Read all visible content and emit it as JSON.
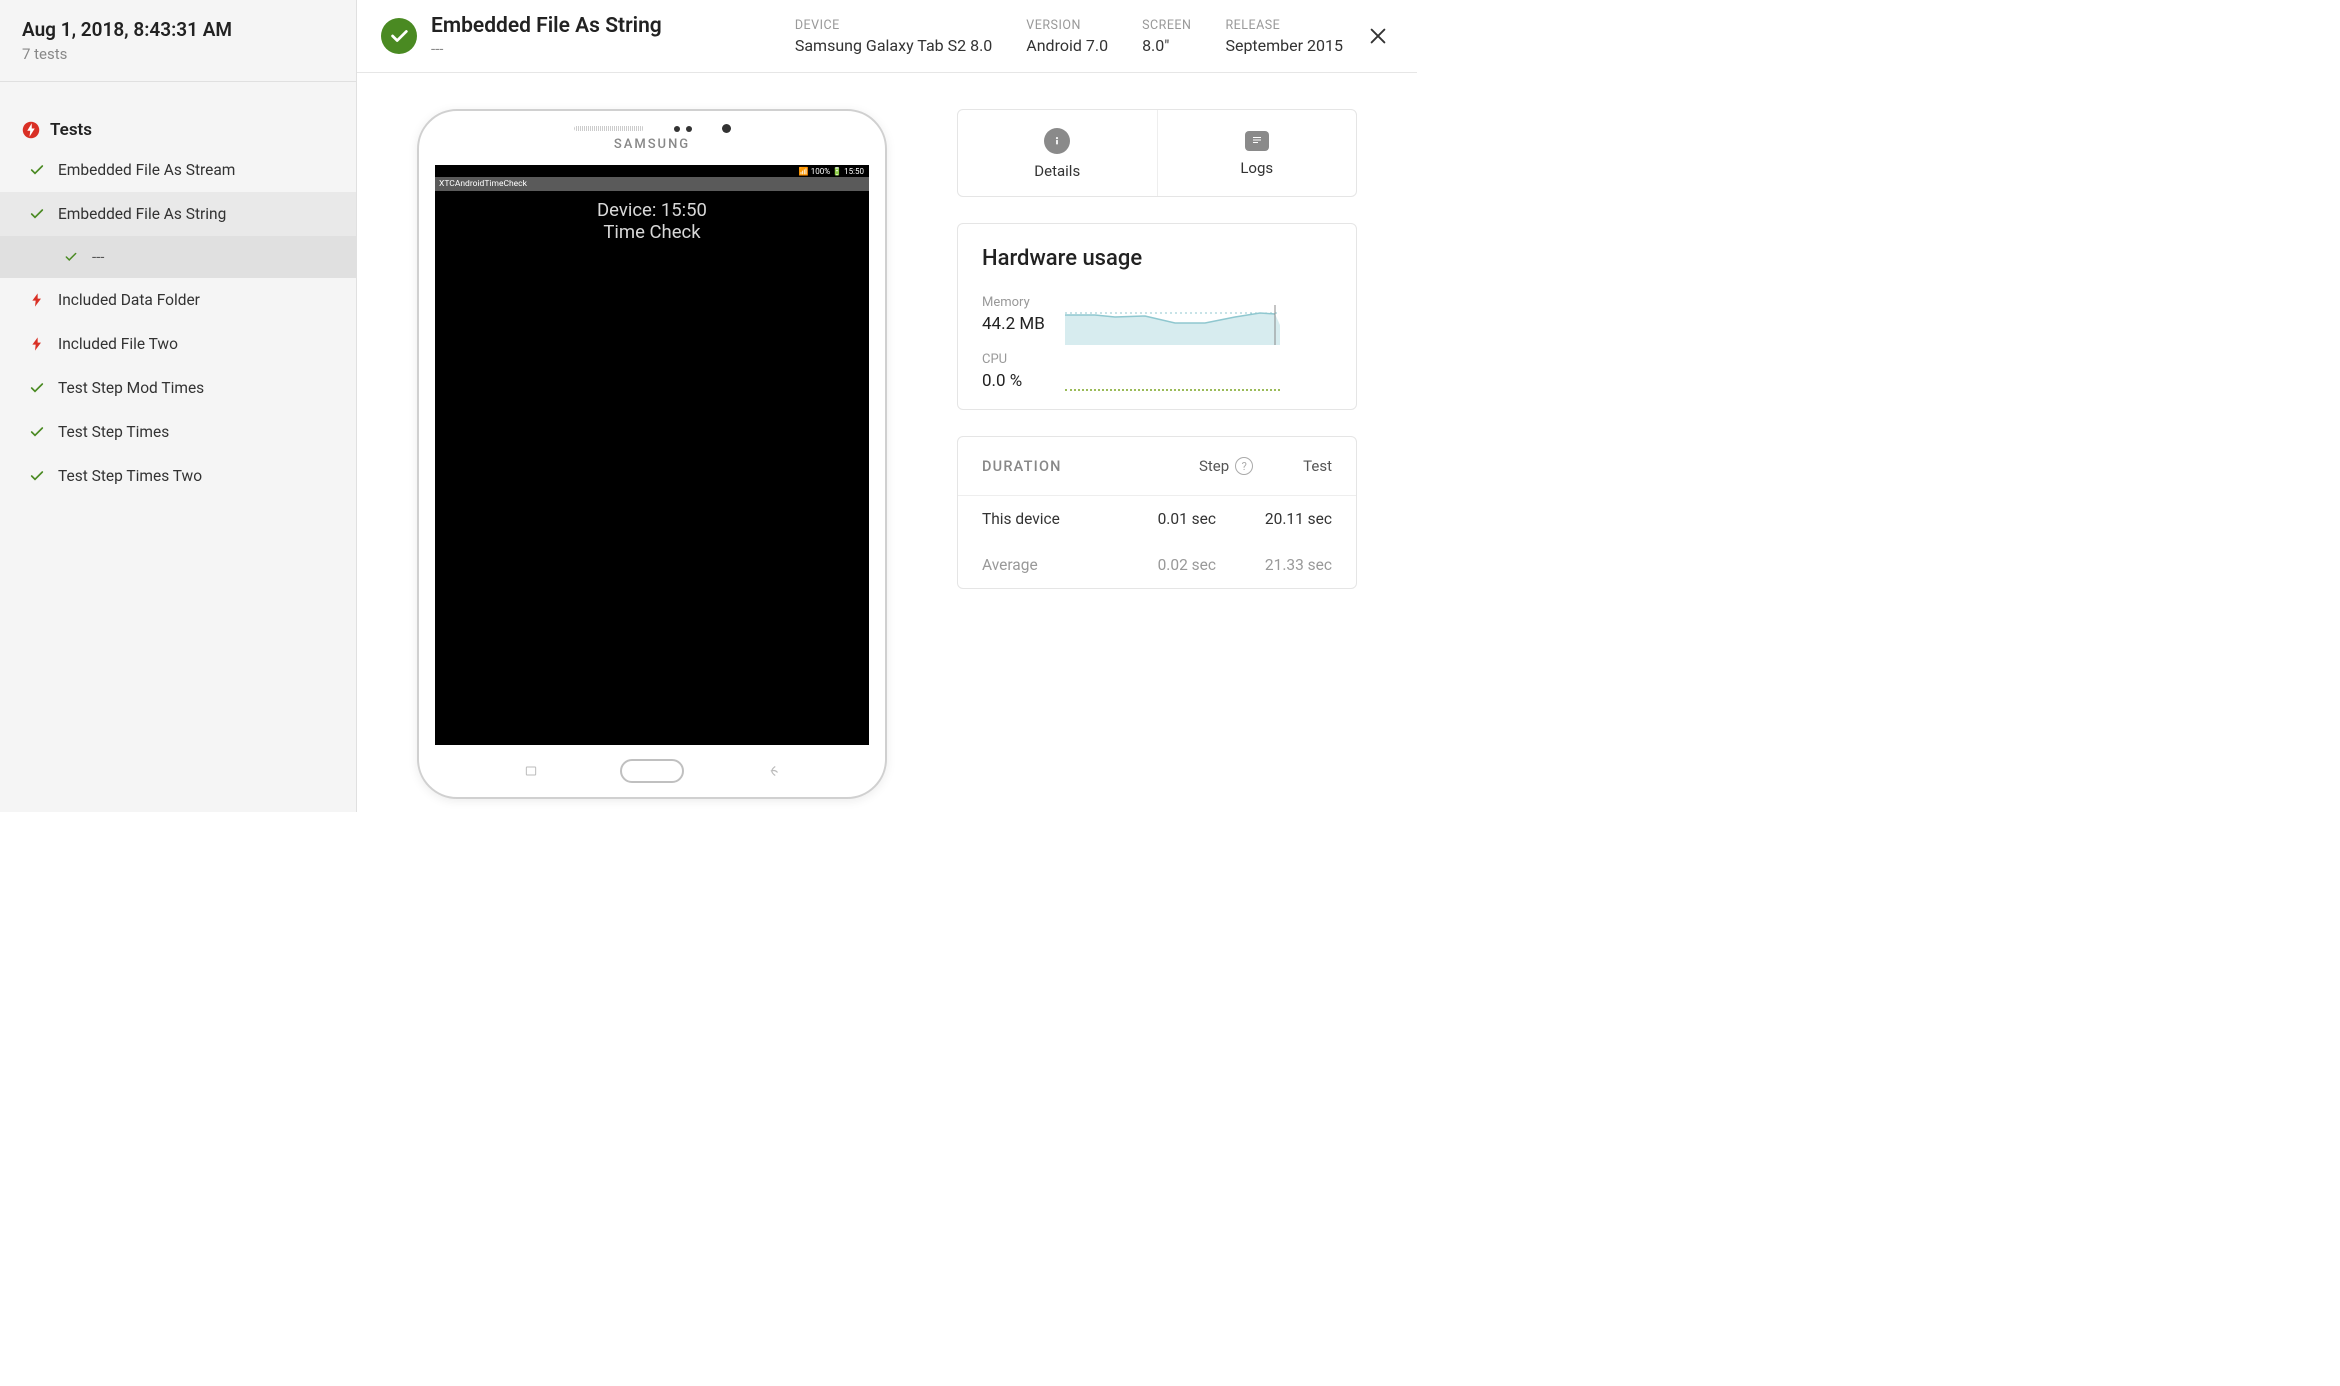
{
  "sidebar": {
    "timestamp": "Aug 1, 2018, 8:43:31 AM",
    "subtitle": "7 tests",
    "heading": "Tests",
    "items": [
      {
        "label": "Embedded File As Stream",
        "status": "pass"
      },
      {
        "label": "Embedded File As String",
        "status": "pass",
        "selected": true,
        "children": [
          {
            "label": "---",
            "status": "pass"
          }
        ]
      },
      {
        "label": "Included Data Folder",
        "status": "fail"
      },
      {
        "label": "Included File Two",
        "status": "fail"
      },
      {
        "label": "Test Step Mod Times",
        "status": "pass"
      },
      {
        "label": "Test Step Times",
        "status": "pass"
      },
      {
        "label": "Test Step Times Two",
        "status": "pass"
      }
    ]
  },
  "header": {
    "title": "Embedded File As String",
    "subtitle": "---",
    "meta": {
      "device_label": "DEVICE",
      "device_value": "Samsung Galaxy Tab S2 8.0",
      "version_label": "VERSION",
      "version_value": "Android 7.0",
      "screen_label": "SCREEN",
      "screen_value": "8.0\"",
      "release_label": "RELEASE",
      "release_value": "September 2015"
    }
  },
  "device_mock": {
    "brand": "SAMSUNG",
    "statusbar": "📶 100% 🔋 15:50",
    "appbar": "XTCAndroidTimeCheck",
    "line1": "Device: 15:50",
    "line2": "Time Check"
  },
  "tabs": {
    "details": "Details",
    "logs": "Logs"
  },
  "hardware": {
    "title": "Hardware usage",
    "memory_label": "Memory",
    "memory_value": "44.2 MB",
    "cpu_label": "CPU",
    "cpu_value": "0.0 %"
  },
  "duration": {
    "title": "DURATION",
    "col_step": "Step",
    "col_test": "Test",
    "rows": [
      {
        "label": "This device",
        "step": "0.01 sec",
        "test": "20.11 sec"
      },
      {
        "label": "Average",
        "step": "0.02 sec",
        "test": "21.33 sec",
        "avg": true
      }
    ]
  },
  "chart_data": {
    "type": "line",
    "title": "Hardware usage",
    "series": [
      {
        "name": "Memory",
        "label": "44.2 MB",
        "values": [
          44,
          44,
          44.5,
          44,
          43,
          43,
          44,
          46,
          46.5,
          44.2
        ],
        "ylim": [
          0,
          60
        ],
        "color": "#b7dce0",
        "fill": true
      },
      {
        "name": "CPU",
        "label": "0.0 %",
        "values": [
          0,
          0,
          0,
          0,
          0,
          0,
          0,
          0,
          0,
          0
        ],
        "ylim": [
          0,
          100
        ],
        "color": "#9bbb59"
      }
    ],
    "x": [
      0,
      1,
      2,
      3,
      4,
      5,
      6,
      7,
      8,
      9
    ]
  }
}
